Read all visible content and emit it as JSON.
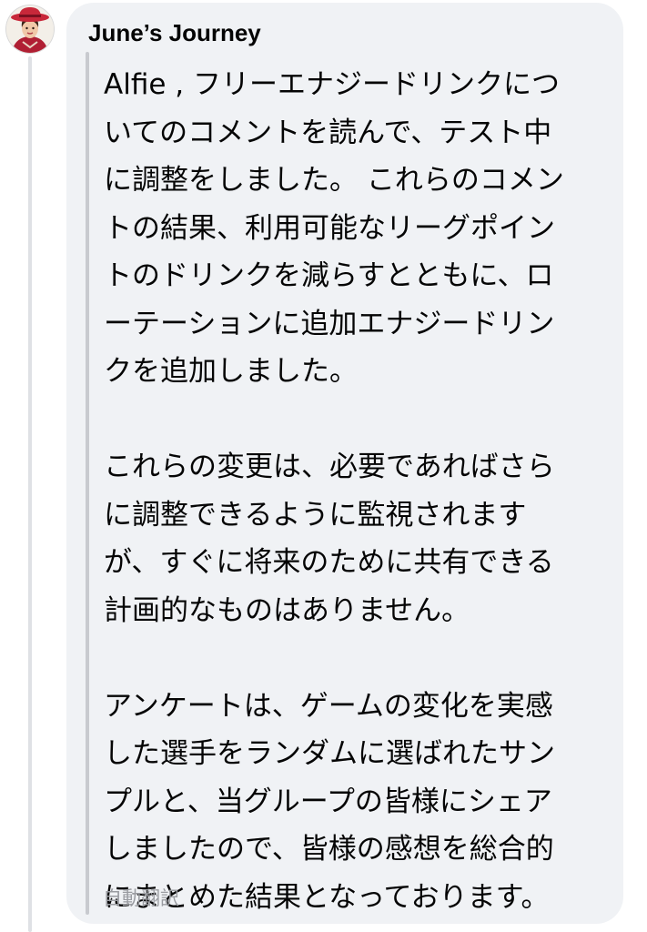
{
  "comment": {
    "author": "June’s Journey",
    "avatar_icon": "avatar-june-red-hat-icon",
    "paragraphs": [
      "Alfie , フリーエナジードリンクにつ\nいてのコメントを読んで、テスト中\nに調整をしました。 これらのコメン\nトの結果、利用可能なリーグポイン\nトのドリンクを減らすとともに、ロ\nーテーションに追加エナジードリン\nクを追加しました。",
      "これらの変更は、必要であればさら\nに調整できるように監視されます\nが、すぐに将来のために共有できる\n計画的なものはありません。",
      "アンケートは、ゲームの変化を実感\nした選手をランダムに選ばれたサン\nプルと、当グループの皆様にシェア\nしましたので、皆様の感想を総合的\nにまとめた結果となっております。"
    ],
    "translation_label": "自動翻訳"
  },
  "colors": {
    "bubble_background": "#f0f2f5",
    "text": "#050505",
    "muted_text": "#9a9ca1",
    "hat_red": "#c8283a"
  }
}
